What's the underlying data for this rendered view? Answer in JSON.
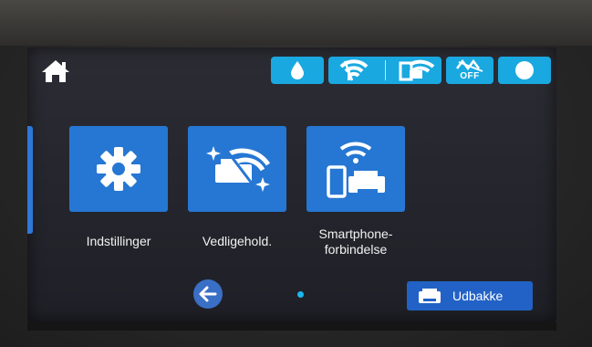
{
  "colors": {
    "accent_blue": "#2677d3",
    "status_cyan": "#1aa8e0",
    "page_dot": "#1ab8ef",
    "label_text": "#f2f2f2"
  },
  "header": {
    "home_icon": "home-icon",
    "status_icons": [
      "ink-drop-icon",
      "wifi-off-icon",
      "wifi-direct-icon",
      "wifi-off-icon",
      "circle-icon"
    ],
    "status_text": "OFF"
  },
  "apps": [
    {
      "label": "Indstillinger",
      "icon": "gear-icon"
    },
    {
      "label": "Vedligehold.",
      "icon": "maintenance-icon"
    },
    {
      "label": "Smartphone-\nforbindelse",
      "icon": "smartphone-connection-icon"
    }
  ],
  "footer": {
    "back_icon": "back-arrow-icon",
    "page_indicator": {
      "current": 1,
      "total": 1
    },
    "outbox_label": "Udbakke",
    "outbox_icon": "printer-tray-icon"
  }
}
